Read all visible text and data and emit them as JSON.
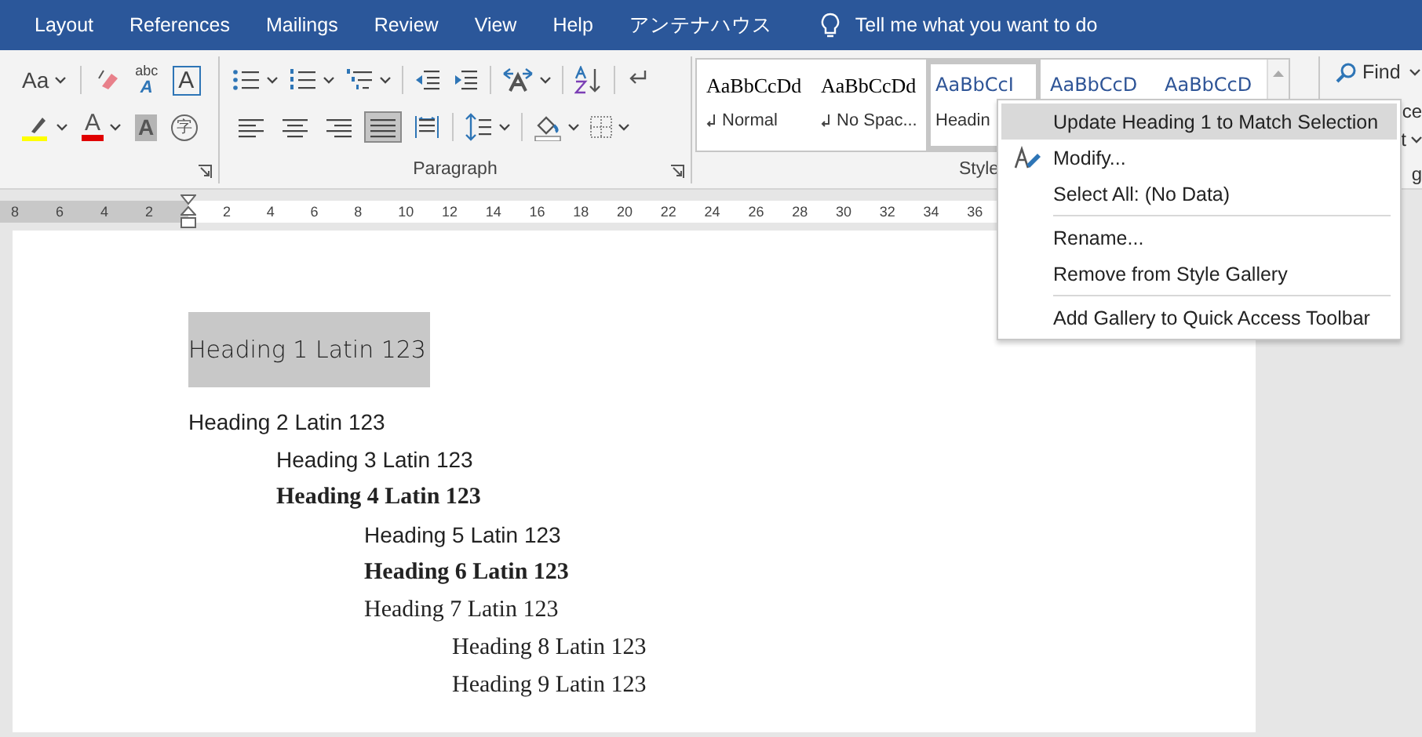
{
  "tabs": [
    {
      "label": "Layout"
    },
    {
      "label": "References"
    },
    {
      "label": "Mailings"
    },
    {
      "label": "Review"
    },
    {
      "label": "View"
    },
    {
      "label": "Help"
    },
    {
      "label": "アンテナハウス"
    }
  ],
  "tell_me": {
    "placeholder": "Tell me what you want to do"
  },
  "font_group": {
    "change_case": "Aa",
    "abc": "abc",
    "effects_letter": "A",
    "border_letter": "A",
    "font_color_letter": "A",
    "shading_letter": "A",
    "enclosed_char": "字"
  },
  "paragraph_group": {
    "label": "Paragraph",
    "align_buttons": [
      {
        "selected": false
      },
      {
        "selected": false
      },
      {
        "selected": false
      },
      {
        "selected": true
      },
      {
        "selected": false
      }
    ]
  },
  "styles_group": {
    "label": "Style",
    "items": [
      {
        "sample": "AaBbCcDd",
        "name": "Normal",
        "para_mark": true,
        "selected": false,
        "kind": "body"
      },
      {
        "sample": "AaBbCcDd",
        "name": "No Spac...",
        "para_mark": true,
        "selected": false,
        "kind": "body"
      },
      {
        "sample": "AaBbCcI",
        "name": "Headin",
        "para_mark": false,
        "selected": true,
        "kind": "heading"
      },
      {
        "sample": "AaBbCcD",
        "selected": false,
        "kind": "heading"
      },
      {
        "sample": "AaBbCcD",
        "selected": false,
        "kind": "heading"
      }
    ]
  },
  "editing_group": {
    "find": "Find",
    "replace_part": "ce",
    "select_part": "t",
    "label_part": "g"
  },
  "ruler": {
    "left_marks": [
      "8",
      "6",
      "4",
      "2"
    ],
    "marks": [
      "2",
      "4",
      "6",
      "8",
      "10",
      "12",
      "14",
      "16",
      "18",
      "20",
      "22",
      "24",
      "26",
      "28",
      "30",
      "32",
      "34",
      "36"
    ]
  },
  "document": {
    "headings": [
      {
        "text": "Heading 1 Latin 123",
        "kind": "sans-large",
        "bold": false,
        "selected": true
      },
      {
        "text": "Heading 2 Latin 123",
        "kind": "sans",
        "bold": false,
        "selected": false,
        "children": [
          {
            "text": "Heading 3 Latin 123",
            "kind": "sans",
            "bold": false,
            "selected": false
          },
          {
            "text": "Heading 4 Latin 123",
            "kind": "serif",
            "bold": true,
            "selected": false,
            "children": [
              {
                "text": "Heading 5 Latin 123",
                "kind": "sans",
                "bold": false,
                "selected": false
              },
              {
                "text": "Heading 6 Latin 123",
                "kind": "serif",
                "bold": true,
                "selected": false
              },
              {
                "text": "Heading 7 Latin 123",
                "kind": "serif",
                "bold": false,
                "selected": false,
                "children": [
                  {
                    "text": "Heading 8 Latin 123",
                    "kind": "serif",
                    "bold": false,
                    "selected": false
                  },
                  {
                    "text": "Heading 9 Latin 123",
                    "kind": "serif",
                    "bold": false,
                    "selected": false
                  }
                ]
              }
            ]
          }
        ]
      }
    ]
  },
  "context_menu": {
    "items": [
      {
        "label": "Update Heading 1 to Match Selection",
        "selected": true,
        "icon": false,
        "separator_before": false
      },
      {
        "label": "Modify...",
        "selected": false,
        "icon": true,
        "separator_before": false
      },
      {
        "label": "Select All: (No Data)",
        "selected": false,
        "icon": false,
        "separator_before": false
      },
      {
        "label": "Rename...",
        "selected": false,
        "icon": false,
        "separator_before": true
      },
      {
        "label": "Remove from Style Gallery",
        "selected": false,
        "icon": false,
        "separator_before": false
      },
      {
        "label": "Add Gallery to Quick Access Toolbar",
        "selected": false,
        "icon": false,
        "separator_before": true
      }
    ]
  }
}
